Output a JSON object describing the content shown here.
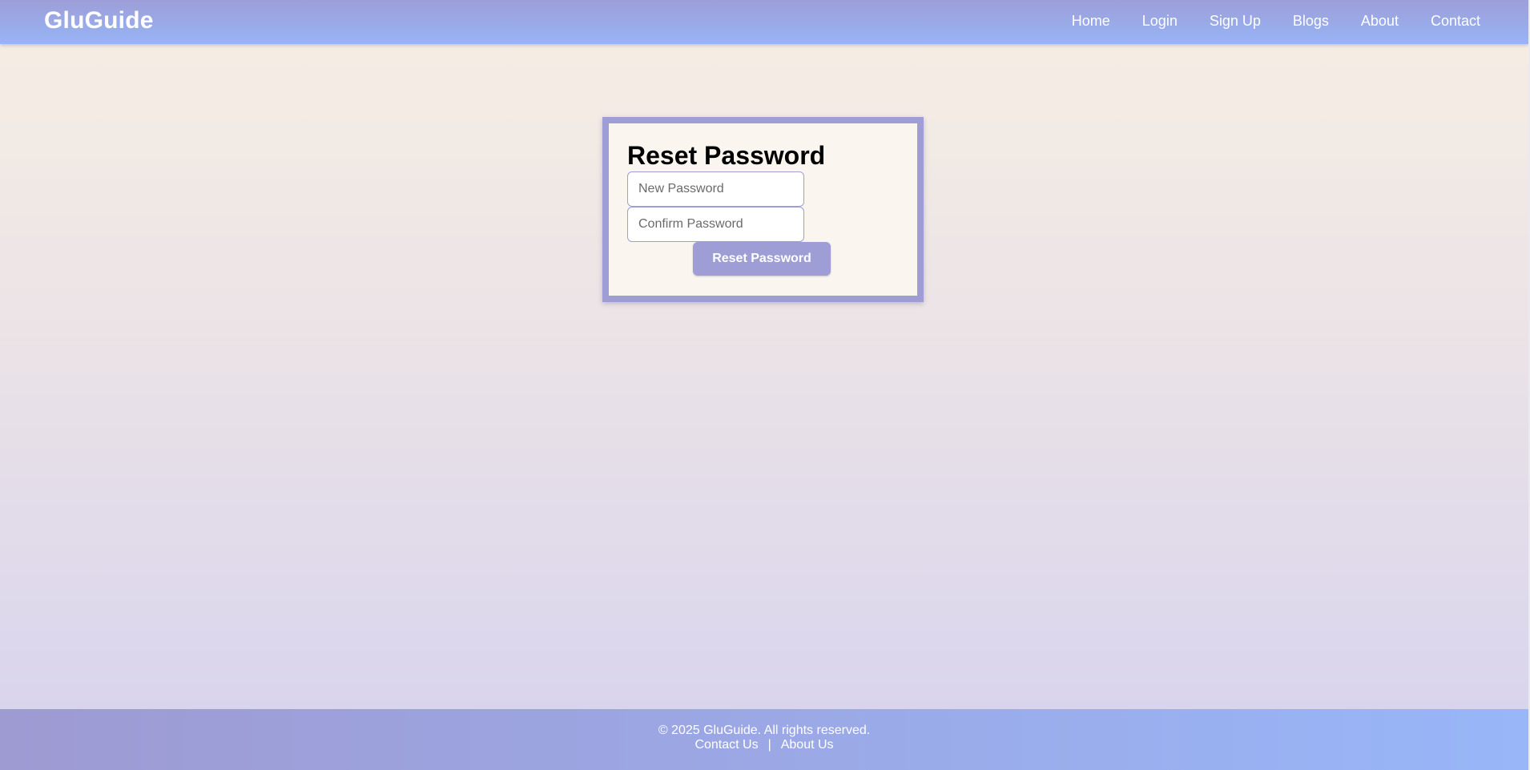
{
  "nav": {
    "brand": "GluGuide",
    "links": [
      "Home",
      "Login",
      "Sign Up",
      "Blogs",
      "About",
      "Contact"
    ]
  },
  "reset_form": {
    "title": "Reset Password",
    "new_password_placeholder": "New Password",
    "confirm_password_placeholder": "Confirm Password",
    "submit_label": "Reset Password"
  },
  "footer": {
    "copyright": "© 2025 GluGuide. All rights reserved.",
    "links": [
      "Contact Us",
      "About Us"
    ],
    "separator": "|"
  },
  "colors": {
    "accent": "#9f9dd6",
    "nav_gradient_end": "#97b4f6",
    "card_background": "#faf6ef"
  }
}
